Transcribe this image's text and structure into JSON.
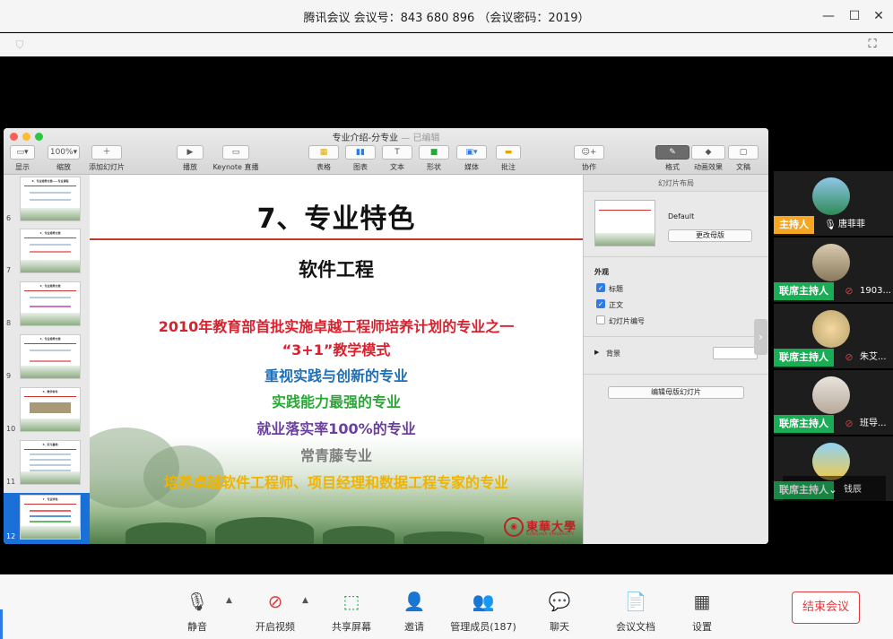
{
  "window": {
    "title": "腾讯会议 会议号：843 680 896 （会议密码：2019）"
  },
  "keynote": {
    "doc_title": "专业介绍-分专业",
    "doc_status": "— 已编辑",
    "toolbar": [
      {
        "label": "显示",
        "icon": "view-icon"
      },
      {
        "label": "缩放",
        "value": "100%",
        "icon": "zoom-select"
      },
      {
        "label": "添加幻灯片",
        "icon": "plus-icon"
      },
      {
        "label": "播放",
        "icon": "play-icon"
      },
      {
        "label": "Keynote 直播",
        "icon": "live-icon"
      },
      {
        "label": "表格",
        "icon": "table-icon"
      },
      {
        "label": "图表",
        "icon": "chart-icon"
      },
      {
        "label": "文本",
        "icon": "text-icon"
      },
      {
        "label": "形状",
        "icon": "shape-icon"
      },
      {
        "label": "媒体",
        "icon": "media-icon"
      },
      {
        "label": "批注",
        "icon": "comment-icon"
      },
      {
        "label": "协作",
        "icon": "collaborate-icon"
      },
      {
        "label": "格式",
        "icon": "format-icon"
      },
      {
        "label": "动画效果",
        "icon": "animate-icon"
      },
      {
        "label": "文稿",
        "icon": "document-icon"
      }
    ],
    "slides": [
      {
        "num": "6",
        "heading": "6．专业培养方案——专业课程"
      },
      {
        "num": "7",
        "heading": "4．专业培养方案"
      },
      {
        "num": "8",
        "heading": "4．专业培养方案"
      },
      {
        "num": "9",
        "heading": "4．专业培养方案"
      },
      {
        "num": "10",
        "heading": "5．教学条件"
      },
      {
        "num": "11",
        "heading": "6．实习基地"
      },
      {
        "num": "12",
        "heading": "7．专业特色"
      }
    ],
    "slide": {
      "title": "7、专业特色",
      "subtitle": "软件工程",
      "lines": [
        {
          "text": "2010年教育部首批实施卓越工程师培养计划的专业之一",
          "color": "#d9212e"
        },
        {
          "text": "“3+1”教学模式",
          "color": "#d9212e"
        },
        {
          "text": "重视实践与创新的专业",
          "color": "#1d6fb8"
        },
        {
          "text": "实践能力最强的专业",
          "color": "#2aa836"
        },
        {
          "text": "就业落实率100%的专业",
          "color": "#6b3fa0"
        },
        {
          "text": "常青藤专业",
          "color": "#7f7f7f"
        },
        {
          "text": "培养卓越软件工程师、项目经理和数据工程专家的专业",
          "color": "#f0b400"
        }
      ],
      "logo_cn": "東華大學",
      "logo_en": "DONGHUA UNIVERSITY"
    },
    "inspector": {
      "header": "幻灯片布局",
      "layout_name": "Default",
      "change_master": "更改母版",
      "appearance": "外观",
      "opt_title": "标题",
      "opt_body": "正文",
      "opt_slide_number": "幻灯片编号",
      "background": "背景",
      "edit_master": "编辑母版幻灯片"
    }
  },
  "participants": [
    {
      "role": "主持人",
      "name": "唐菲菲",
      "role_color": "#f5a623",
      "mic": "on"
    },
    {
      "role": "联席主持人",
      "name": "1903...",
      "role_color": "#1aad55",
      "mic": "muted"
    },
    {
      "role": "联席主持人",
      "name": "朱艾...",
      "role_color": "#1aad55",
      "mic": "muted"
    },
    {
      "role": "联席主持人",
      "name": "班导...",
      "role_color": "#1aad55",
      "mic": "muted"
    },
    {
      "role": "联席主持人",
      "name": "钱辰",
      "role_color": "#1aad55",
      "mic": "muted"
    }
  ],
  "toolbar": {
    "mute": "静音",
    "video": "开启视频",
    "share": "共享屏幕",
    "invite": "邀请",
    "members": "管理成员(187)",
    "chat": "聊天",
    "docs": "会议文档",
    "settings": "设置",
    "end": "结束会议"
  }
}
